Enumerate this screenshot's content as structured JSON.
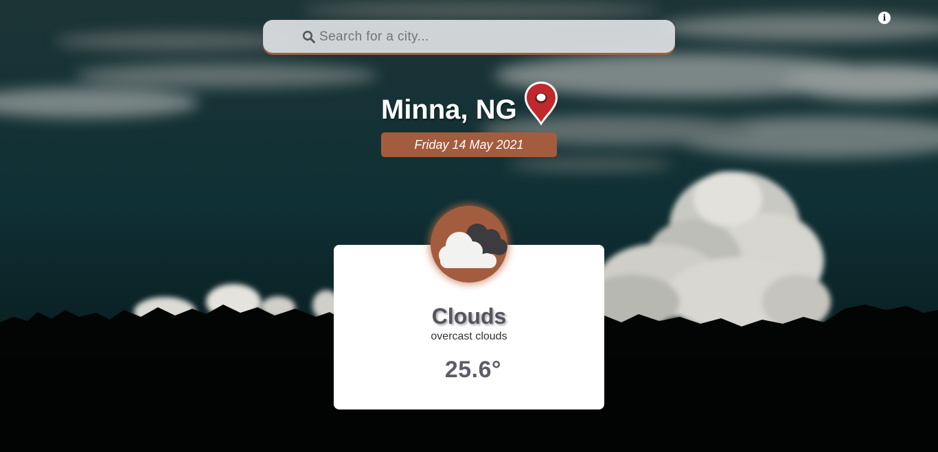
{
  "info": {
    "icon": "info-icon",
    "glyph": "i"
  },
  "search": {
    "placeholder": "Search for a city...",
    "value": "",
    "icon": "search-icon"
  },
  "location": {
    "city": "Minna, NG",
    "icon": "map-pin-icon",
    "date": "Friday 14 May 2021"
  },
  "weather": {
    "main": "Clouds",
    "description": "overcast clouds",
    "temperature": "25.6°",
    "icon": "clouds-icon"
  },
  "colors": {
    "accent": "#a35c3e",
    "pin": "#c0282c",
    "card": "#ffffff",
    "sky": "#0d2629"
  }
}
